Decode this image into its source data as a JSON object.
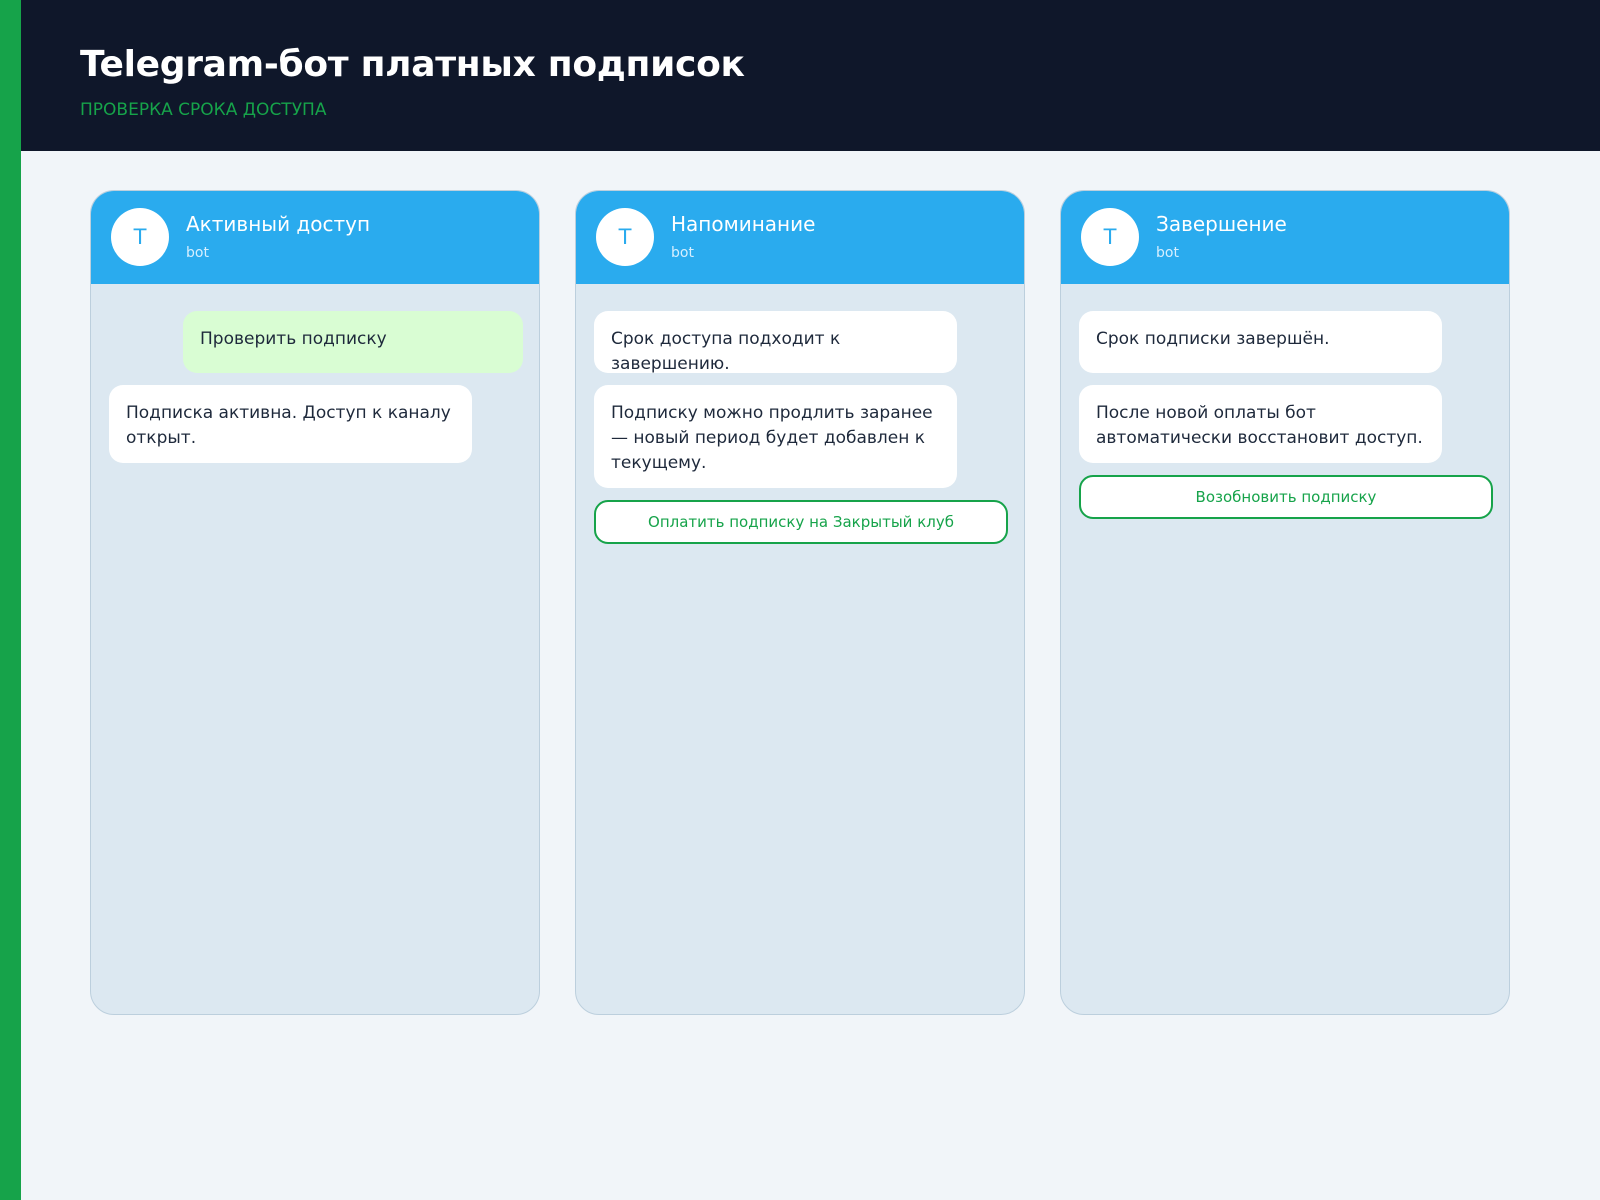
{
  "header": {
    "title": "Telegram-бот платных подписок",
    "subtitle": "ПРОВЕРКА СРОКА ДОСТУПА"
  },
  "colors": {
    "accent": "#16a34a",
    "header_bg": "#0f172a",
    "telegram_blue": "#2aabee",
    "chat_bg": "#dce8f1",
    "outgoing_bubble": "#d9fdd3"
  },
  "panels": [
    {
      "avatar_letter": "T",
      "name": "Активный доступ",
      "status": "bot",
      "messages": [
        {
          "direction": "out",
          "text": "Проверить подписку"
        },
        {
          "direction": "in",
          "text": "Подписка активна. Доступ к каналу открыт."
        }
      ]
    },
    {
      "avatar_letter": "T",
      "name": "Напоминание",
      "status": "bot",
      "messages": [
        {
          "direction": "in",
          "text": "Срок доступа подходит к завершению."
        },
        {
          "direction": "in",
          "text": "Подписку можно продлить заранее — новый период будет добавлен к текущему."
        }
      ],
      "button_label": "Оплатить подписку на Закрытый клуб"
    },
    {
      "avatar_letter": "T",
      "name": "Завершение",
      "status": "bot",
      "messages": [
        {
          "direction": "in",
          "text": "Срок подписки завершён."
        },
        {
          "direction": "in",
          "text": "После новой оплаты бот автоматически восстановит доступ."
        }
      ],
      "button_label": "Возобновить подписку"
    }
  ]
}
